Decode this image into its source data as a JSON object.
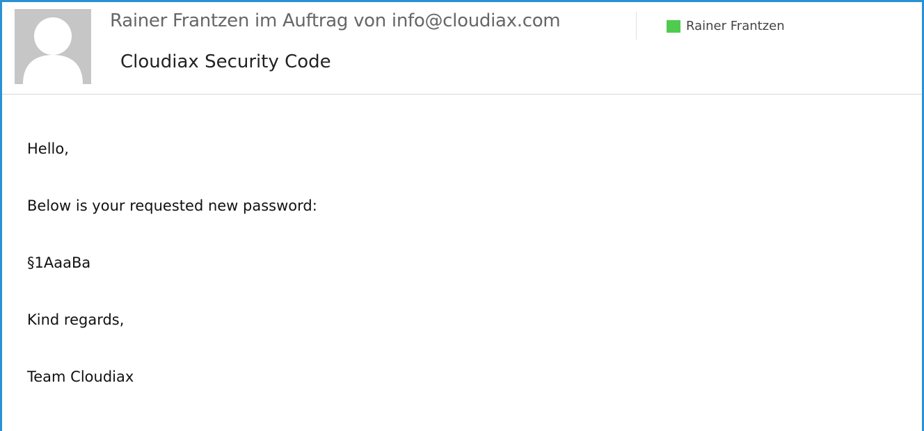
{
  "header": {
    "from_line": "Rainer Frantzen im Auftrag von info@cloudiax.com",
    "subject": "Cloudiax Security Code",
    "category": {
      "label": "Rainer Frantzen",
      "color": "#4fcb4f"
    },
    "avatar_icon": "person-silhouette-icon"
  },
  "message": {
    "lines": [
      "Hello,",
      "Below is your requested new password:",
      "§1AaaBa",
      "Kind regards,",
      "Team Cloudiax"
    ]
  },
  "colors": {
    "frame_accent": "#2b91d5",
    "avatar_bg": "#c6c6c6"
  }
}
